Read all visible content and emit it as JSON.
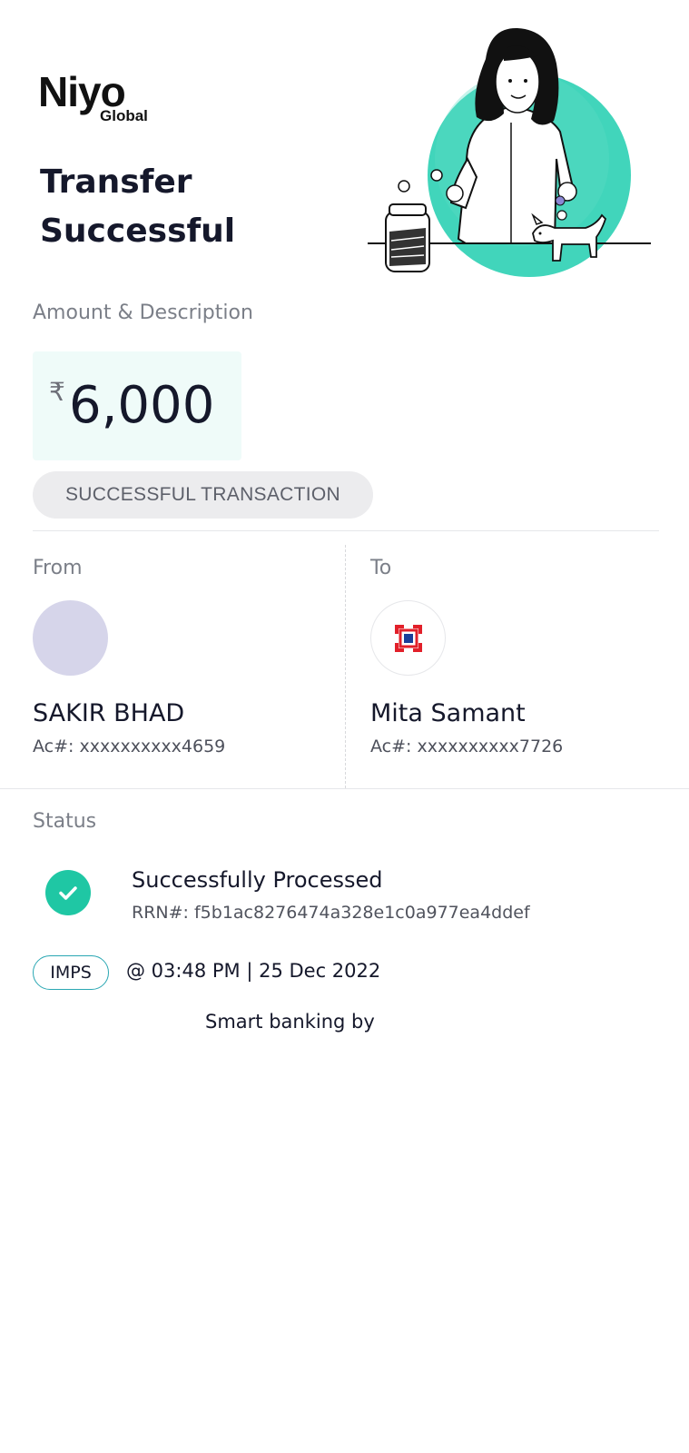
{
  "brand": {
    "name": "Niyo",
    "sub": "Global"
  },
  "header": {
    "title_line1": "Transfer",
    "title_line2": "Successful"
  },
  "amount_section": {
    "label": "Amount & Description",
    "currency_symbol": "₹",
    "amount": "6,000",
    "status_pill": "SUCCESSFUL TRANSACTION"
  },
  "from": {
    "label": "From",
    "name": "SAKIR BHAD",
    "account": "Ac#: xxxxxxxxxx4659"
  },
  "to": {
    "label": "To",
    "name": "Mita Samant",
    "account": "Ac#: xxxxxxxxxx7726"
  },
  "status": {
    "label": "Status",
    "title": "Successfully Processed",
    "rrn": "RRN#: f5b1ac8276474a328e1c0a977ea4ddef"
  },
  "transfer": {
    "mode": "IMPS",
    "timestamp": "@ 03:48 PM | 25 Dec 2022"
  },
  "footer": {
    "text": "Smart banking by"
  },
  "colors": {
    "accent": "#1fc7a4",
    "amount_bg": "#effbf9",
    "imps_border": "#2aa7b3",
    "bank_red": "#e2202a",
    "bank_blue": "#1b3f9a"
  }
}
